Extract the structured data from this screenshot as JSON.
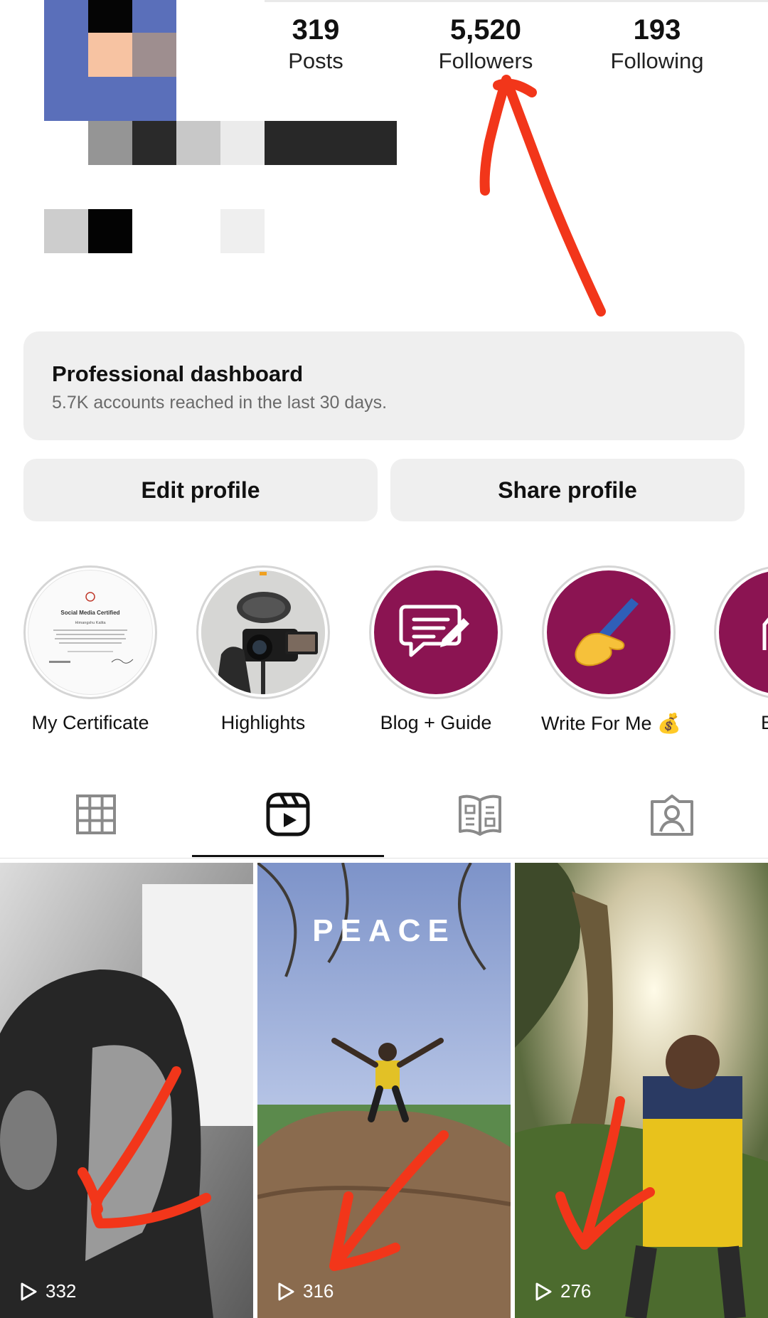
{
  "profile": {
    "stats": [
      {
        "value": "319",
        "label": "Posts"
      },
      {
        "value": "5,520",
        "label": "Followers"
      },
      {
        "value": "193",
        "label": "Following"
      }
    ]
  },
  "dashboard": {
    "title": "Professional dashboard",
    "subtitle": "5.7K accounts reached in the last 30 days."
  },
  "actions": {
    "edit_label": "Edit profile",
    "share_label": "Share profile"
  },
  "highlights": [
    {
      "label": "My Certificate",
      "icon": "certificate-thumbnail"
    },
    {
      "label": "Highlights",
      "icon": "camera-thumbnail"
    },
    {
      "label": "Blog + Guide",
      "icon": "message-edit-icon"
    },
    {
      "label": "Write For Me 💰",
      "icon": "writing-hand-icon"
    },
    {
      "label": "B",
      "icon": "partial-highlight"
    }
  ],
  "certificate": {
    "heading": "Social Media Certified",
    "name": "Himangshu Kalita"
  },
  "tabs": [
    {
      "name": "grid",
      "icon": "grid-icon"
    },
    {
      "name": "reels",
      "icon": "reels-icon",
      "active": true
    },
    {
      "name": "guides",
      "icon": "guide-icon"
    },
    {
      "name": "tagged",
      "icon": "tagged-icon"
    }
  ],
  "reels": [
    {
      "views": "332"
    },
    {
      "views": "316",
      "overlay_text": "PEACE"
    },
    {
      "views": "276"
    }
  ],
  "colors": {
    "highlight_purple": "#8b1452",
    "annotation_red": "#f2361a",
    "button_gray": "#efefef"
  }
}
